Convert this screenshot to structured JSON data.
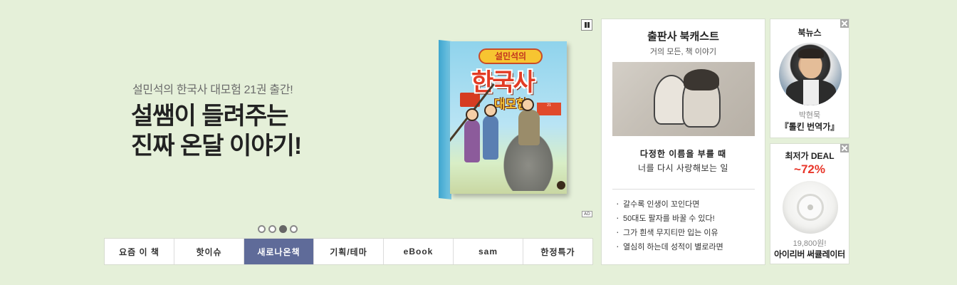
{
  "hero": {
    "subtitle": "설민석의 한국사 대모험 21권 출간!",
    "headline_line1": "설쌤이 들려주는",
    "headline_line2": "진짜 온달 이야기!",
    "ad_badge": "AD",
    "book": {
      "series_label": "설민석의",
      "title": "한국사",
      "subtitle": "대모험",
      "volume": "21"
    },
    "slides_total": 4,
    "slides_active_index": 3
  },
  "tabs": [
    {
      "label": "요즘 이 책",
      "active": false
    },
    {
      "label": "핫이슈",
      "active": false
    },
    {
      "label": "새로나온책",
      "active": true
    },
    {
      "label": "기획/테마",
      "active": false
    },
    {
      "label": "eBook",
      "active": false
    },
    {
      "label": "sam",
      "active": false
    },
    {
      "label": "한정특가",
      "active": false
    }
  ],
  "podcast": {
    "title": "출판사 북캐스트",
    "subtitle": "거의 모든, 책 이야기",
    "book_title": "다정한 이름을 부를 때",
    "book_subtitle": "너를 다시 사랑해보는 일",
    "items": [
      "갈수록 인생이 꼬인다면",
      "50대도 팔자를 바꿀 수 있다!",
      "그가 흰색 무지티만 입는 이유",
      "열심히 하는데 성적이 별로라면"
    ]
  },
  "booknews": {
    "title": "북뉴스",
    "name": "박현묵",
    "role": "『톨킨 번역가』"
  },
  "deal": {
    "title": "최저가 DEAL",
    "discount": "~72%",
    "price": "19,800원!",
    "product": "아이리버 써큘레이터"
  },
  "colors": {
    "background": "#e5f0d9",
    "active_tab": "#5f6b99",
    "discount": "#e8362a"
  }
}
